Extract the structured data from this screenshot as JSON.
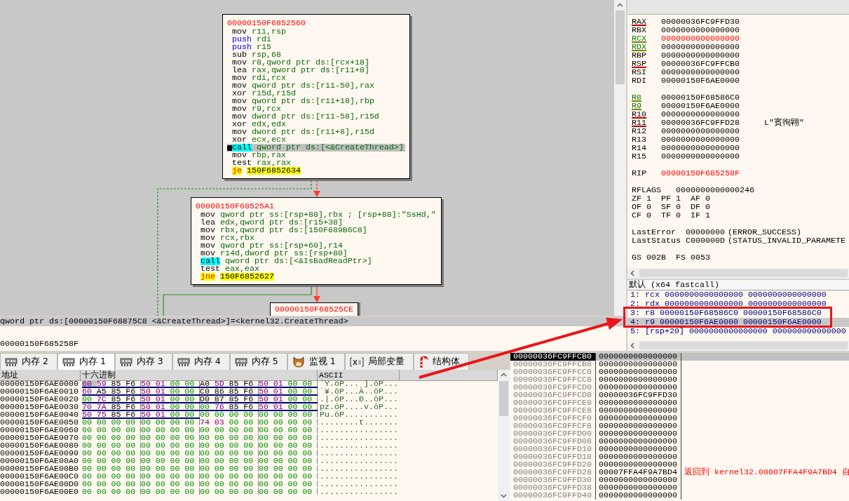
{
  "graph": {
    "nodes": [
      {
        "address": "00000150F6852560",
        "instructions": [
          {
            "mnemonic": "mov",
            "operands": "r11,rsp",
            "kind": "plain",
            "selected": false
          },
          {
            "mnemonic": "push",
            "operands": "rdi",
            "kind": "push",
            "selected": false
          },
          {
            "mnemonic": "push",
            "operands": "r15",
            "kind": "push",
            "selected": false
          },
          {
            "mnemonic": "sub",
            "operands": "rsp,68",
            "kind": "plain",
            "selected": false
          },
          {
            "mnemonic": "mov",
            "operands": "r8,qword ptr ds:[rcx+18]",
            "kind": "plain",
            "selected": false
          },
          {
            "mnemonic": "lea",
            "operands": "rax,qword ptr ds:[r11+8]",
            "kind": "plain",
            "selected": false
          },
          {
            "mnemonic": "mov",
            "operands": "rdi,rcx",
            "kind": "plain",
            "selected": false
          },
          {
            "mnemonic": "mov",
            "operands": "qword ptr ds:[r11-50],rax",
            "kind": "plain",
            "selected": false
          },
          {
            "mnemonic": "xor",
            "operands": "r15d,r15d",
            "kind": "plain",
            "selected": false
          },
          {
            "mnemonic": "mov",
            "operands": "qword ptr ds:[r11+18],rbp",
            "kind": "plain",
            "selected": false
          },
          {
            "mnemonic": "mov",
            "operands": "r9,rcx",
            "kind": "plain",
            "selected": false
          },
          {
            "mnemonic": "mov",
            "operands": "dword ptr ds:[r11-58],r15d",
            "kind": "plain",
            "selected": false
          },
          {
            "mnemonic": "xor",
            "operands": "edx,edx",
            "kind": "plain",
            "selected": false
          },
          {
            "mnemonic": "mov",
            "operands": "dword ptr ds:[r11+8],r15d",
            "kind": "plain",
            "selected": false
          },
          {
            "mnemonic": "xor",
            "operands": "ecx,ecx",
            "kind": "plain",
            "selected": false
          },
          {
            "mnemonic": "call",
            "operands": "qword ptr ds:[<&CreateThread>]",
            "kind": "call",
            "selected": true
          },
          {
            "mnemonic": "mov",
            "operands": "rbp,rax",
            "kind": "plain",
            "selected": false
          },
          {
            "mnemonic": "test",
            "operands": "rax,rax",
            "kind": "plain",
            "selected": false
          },
          {
            "mnemonic": "je",
            "operands": "150F6852634",
            "kind": "jump",
            "selected": false
          }
        ]
      },
      {
        "address": "00000150F68525A1",
        "instructions": [
          {
            "mnemonic": "mov",
            "operands": "qword ptr ss:[rsp+88],rbx ; [rsp+88]:\"SsHd,\"",
            "kind": "plain",
            "selected": false
          },
          {
            "mnemonic": "lea",
            "operands": "edx,qword ptr ds:[r15+38]",
            "kind": "plain",
            "selected": false
          },
          {
            "mnemonic": "mov",
            "operands": "rbx,qword ptr ds:[150F689B6C8]",
            "kind": "plain",
            "selected": false
          },
          {
            "mnemonic": "mov",
            "operands": "rcx,rbx",
            "kind": "plain",
            "selected": false
          },
          {
            "mnemonic": "mov",
            "operands": "qword ptr ss:[rsp+60],r14",
            "kind": "plain",
            "selected": false
          },
          {
            "mnemonic": "mov",
            "operands": "r14d,dword ptr ss:[rsp+80]",
            "kind": "plain",
            "selected": false
          },
          {
            "mnemonic": "call",
            "operands": "qword ptr ds:[<&IsBadReadPtr>]",
            "kind": "call",
            "selected": false
          },
          {
            "mnemonic": "test",
            "operands": "eax,eax",
            "kind": "plain",
            "selected": false
          },
          {
            "mnemonic": "jne",
            "operands": "150F6852627",
            "kind": "jump",
            "selected": false
          }
        ]
      },
      {
        "address": "00000150F68525CE"
      }
    ],
    "edges": [
      {
        "kind": "fallthrough",
        "dashed": true
      },
      {
        "kind": "jump",
        "dashed": true
      },
      {
        "kind": "jump",
        "dashed": false
      },
      {
        "kind": "fallthrough",
        "dashed": false
      }
    ]
  },
  "info": {
    "lines": [
      {
        "text": "qword ptr ds:[00000150F68875C8 <&CreateThread>]=<kernel32.CreateThread>",
        "selected": true
      },
      {
        "text": "00000150F685258F",
        "selected": false
      }
    ]
  },
  "registers": {
    "groups": [
      [
        {
          "name": "RAX",
          "value": "00000036FC9FFD30",
          "kind": "modified",
          "changed": false
        },
        {
          "name": "RBX",
          "value": "0000000000000000",
          "kind": "plain",
          "changed": false
        },
        {
          "name": "RCX",
          "value": "0000000000000000",
          "kind": "argument",
          "changed": true
        },
        {
          "name": "RDX",
          "value": "0000000000000000",
          "kind": "argument",
          "changed": false
        },
        {
          "name": "RBP",
          "value": "0000000000000000",
          "kind": "plain",
          "changed": false
        },
        {
          "name": "RSP",
          "value": "00000036FC9FFCB0",
          "kind": "modified",
          "changed": false
        },
        {
          "name": "RSI",
          "value": "0000000000000000",
          "kind": "plain",
          "changed": false
        },
        {
          "name": "RDI",
          "value": "00000150F6AE0000",
          "kind": "plain",
          "changed": false
        }
      ],
      [
        {
          "name": "R8",
          "value": "00000150F68586C0",
          "kind": "argument",
          "changed": false
        },
        {
          "name": "R9",
          "value": "00000150F6AE0000",
          "kind": "argument",
          "changed": false
        },
        {
          "name": "R10",
          "value": "0000000000000000",
          "kind": "modified",
          "changed": false
        },
        {
          "name": "R11",
          "value": "00000036FC9FFD28",
          "kind": "modified",
          "changed": false,
          "comment": "L\"賓徇翶\""
        },
        {
          "name": "R12",
          "value": "0000000000000000",
          "kind": "plain",
          "changed": false
        },
        {
          "name": "R13",
          "value": "0000000000000000",
          "kind": "plain",
          "changed": false
        },
        {
          "name": "R14",
          "value": "0000000000000000",
          "kind": "plain",
          "changed": false
        },
        {
          "name": "R15",
          "value": "0000000000000000",
          "kind": "plain",
          "changed": false
        }
      ],
      [
        {
          "name": "RIP",
          "value": "00000150F685258F",
          "kind": "plain",
          "changed": true
        }
      ]
    ],
    "rflags": {
      "name": "RFLAGS",
      "value": "0000000000000246"
    },
    "flags": [
      [
        {
          "name": "ZF",
          "value": "1"
        },
        {
          "name": "PF",
          "value": "1"
        },
        {
          "name": "AF",
          "value": "0"
        }
      ],
      [
        {
          "name": "OF",
          "value": "0"
        },
        {
          "name": "SF",
          "value": "0"
        },
        {
          "name": "DF",
          "value": "0"
        }
      ],
      [
        {
          "name": "CF",
          "value": "0"
        },
        {
          "name": "TF",
          "value": "0"
        },
        {
          "name": "IF",
          "value": "1"
        }
      ]
    ],
    "errors": [
      {
        "name": "LastError",
        "value": "00000000",
        "description": "(ERROR_SUCCESS)"
      },
      {
        "name": "LastStatus",
        "value": "C000000D",
        "description": "(STATUS_INVALID_PARAMETE"
      }
    ],
    "segments": [
      {
        "name": "GS",
        "value": "002B"
      },
      {
        "name": "FS",
        "value": "0053"
      }
    ]
  },
  "arguments": {
    "title": "默认 (x64 fastcall)",
    "rows": [
      {
        "text": "1: rcx 0000000000000000 0000000000000000",
        "selected": false
      },
      {
        "text": "2: rdx 0000000000000000 0000000000000000",
        "selected": false
      },
      {
        "text": "3: r8 00000150F68586C0 00000150F68586C0",
        "selected": false
      },
      {
        "text": "4: r9 00000150F6AE0000 00000150F6AE0000",
        "selected": true
      },
      {
        "text": "5: [rsp+20] 0000000000000000 000000000000000",
        "selected": false
      }
    ]
  },
  "tabs": [
    {
      "label": "内存 2",
      "kind": "memory",
      "selected": false
    },
    {
      "label": "内存 1",
      "kind": "memory",
      "selected": true
    },
    {
      "label": "内存 3",
      "kind": "memory",
      "selected": false
    },
    {
      "label": "内存 4",
      "kind": "memory",
      "selected": false
    },
    {
      "label": "内存 5",
      "kind": "memory",
      "selected": false
    },
    {
      "label": "监视 1",
      "kind": "watch",
      "selected": false
    },
    {
      "label": "局部变量",
      "kind": "locals",
      "selected": false
    },
    {
      "label": "结构体",
      "kind": "struct",
      "selected": false
    }
  ],
  "dump": {
    "columns": [
      "地址",
      "十六进制",
      "ASCII"
    ],
    "rows": [
      {
        "address": "00000150F6AE0000",
        "bytes": [
          "60 59 85 F6 50 01 00 00",
          "A0 5D 85 F6 50 01 00 00"
        ],
        "pointers": [
          true,
          true
        ],
        "ascii": "`Y.öP... ].öP...",
        "selected": true
      },
      {
        "address": "00000150F6AE0010",
        "bytes": [
          "60 A5 85 F6 50 01 00 00",
          "C0 86 85 F6 50 01 00 00"
        ],
        "pointers": [
          true,
          true
        ],
        "ascii": "`¥.öP...À..öP...",
        "selected": false
      },
      {
        "address": "00000150F6AE0020",
        "bytes": [
          "00 7C 85 F6 50 01 00 00",
          "D0 87 85 F6 50 01 00 00"
        ],
        "pointers": [
          true,
          true
        ],
        "ascii": ".|.öP...Ð..öP...",
        "selected": false
      },
      {
        "address": "00000150F6AE0030",
        "bytes": [
          "70 7A 85 F6 50 01 00 00",
          "00 76 85 F6 50 01 00 00"
        ],
        "pointers": [
          true,
          true
        ],
        "ascii": "pz.öP....v.öP...",
        "selected": false
      },
      {
        "address": "00000150F6AE0040",
        "bytes": [
          "50 75 85 F6 50 01 00 00",
          "00 00 00 00 00 00 00 00"
        ],
        "pointers": [
          true,
          false
        ],
        "ascii": "Pu.öP...........",
        "selected": false
      },
      {
        "address": "00000150F6AE0050",
        "bytes": [
          "00 00 00 00 00 00 00 00",
          "74 03 00 00 00 00 00 00"
        ],
        "pointers": [
          false,
          false
        ],
        "ascii": "........t.......",
        "selected": false
      },
      {
        "address": "00000150F6AE0060",
        "bytes": [
          "00 00 00 00 00 00 00 00",
          "00 00 00 00 00 00 00 00"
        ],
        "pointers": [
          false,
          false
        ],
        "ascii": "................",
        "selected": false
      },
      {
        "address": "00000150F6AE0070",
        "bytes": [
          "00 00 00 00 00 00 00 00",
          "00 00 00 00 00 00 00 00"
        ],
        "pointers": [
          false,
          false
        ],
        "ascii": "................",
        "selected": false
      },
      {
        "address": "00000150F6AE0080",
        "bytes": [
          "00 00 00 00 00 00 00 00",
          "00 00 00 00 00 00 00 00"
        ],
        "pointers": [
          false,
          false
        ],
        "ascii": "................",
        "selected": false
      },
      {
        "address": "00000150F6AE0090",
        "bytes": [
          "00 00 00 00 00 00 00 00",
          "00 00 00 00 00 00 00 00"
        ],
        "pointers": [
          false,
          false
        ],
        "ascii": "................",
        "selected": false
      },
      {
        "address": "00000150F6AE00A0",
        "bytes": [
          "00 00 00 00 00 00 00 00",
          "00 00 00 00 00 00 00 00"
        ],
        "pointers": [
          false,
          false
        ],
        "ascii": "................",
        "selected": false
      },
      {
        "address": "00000150F6AE00B0",
        "bytes": [
          "00 00 00 00 00 00 00 00",
          "00 00 00 00 00 00 00 00"
        ],
        "pointers": [
          false,
          false
        ],
        "ascii": "................",
        "selected": false
      },
      {
        "address": "00000150F6AE00C0",
        "bytes": [
          "00 00 00 00 00 00 00 00",
          "00 00 00 00 00 00 00 00"
        ],
        "pointers": [
          false,
          false
        ],
        "ascii": "................",
        "selected": false
      },
      {
        "address": "00000150F6AE00D0",
        "bytes": [
          "00 00 00 00 00 00 00 00",
          "00 00 00 00 00 00 00 00"
        ],
        "pointers": [
          false,
          false
        ],
        "ascii": "................",
        "selected": false
      },
      {
        "address": "00000150F6AE00E0",
        "bytes": [
          "00 00 00 00 00 00 00 00",
          "00 00 00 00 00 00 00 00"
        ],
        "pointers": [
          false,
          false
        ],
        "ascii": "................",
        "selected": false
      }
    ]
  },
  "stack": {
    "rows": [
      {
        "address": "00000036FC9FFCB0",
        "value": "0000000000000000",
        "selected": true
      },
      {
        "address": "00000036FC9FFCB8",
        "value": "0000000000000000",
        "selected": false
      },
      {
        "address": "00000036FC9FFCC0",
        "value": "0000000000000000",
        "selected": false
      },
      {
        "address": "00000036FC9FFCC8",
        "value": "0000000000000000",
        "selected": false
      },
      {
        "address": "00000036FC9FFCD0",
        "value": "0000000000000000",
        "selected": false
      },
      {
        "address": "00000036FC9FFCD8",
        "value": "00000036FC9FFD30",
        "selected": false
      },
      {
        "address": "00000036FC9FFCE0",
        "value": "0000000000000000",
        "selected": false
      },
      {
        "address": "00000036FC9FFCE8",
        "value": "0000000000000000",
        "selected": false
      },
      {
        "address": "00000036FC9FFCF0",
        "value": "0000000000000000",
        "selected": false
      },
      {
        "address": "00000036FC9FFCF8",
        "value": "0000000000000000",
        "selected": false
      },
      {
        "address": "00000036FC9FFD00",
        "value": "0000000000000000",
        "selected": false
      },
      {
        "address": "00000036FC9FFD08",
        "value": "0000000000000000",
        "selected": false
      },
      {
        "address": "00000036FC9FFD10",
        "value": "0000000000000000",
        "selected": false
      },
      {
        "address": "00000036FC9FFD18",
        "value": "0000000000000000",
        "selected": false
      },
      {
        "address": "00000036FC9FFD20",
        "value": "0000000000000000",
        "selected": false
      },
      {
        "address": "00000036FC9FFD28",
        "value": "00007FFA4F9A7BD4",
        "selected": false,
        "comment": "返回到 kernel32.00007FFA4F9A7BD4 自"
      },
      {
        "address": "00000036FC9FFD30",
        "value": "0000000000000000",
        "selected": false
      },
      {
        "address": "00000036FC9FFD38",
        "value": "0000000000000000",
        "selected": false
      },
      {
        "address": "00000036FC9FFD40",
        "value": "0000000000000000",
        "selected": false
      }
    ]
  },
  "annotations": [
    {
      "kind": "arrow"
    },
    {
      "kind": "rectangle"
    }
  ]
}
